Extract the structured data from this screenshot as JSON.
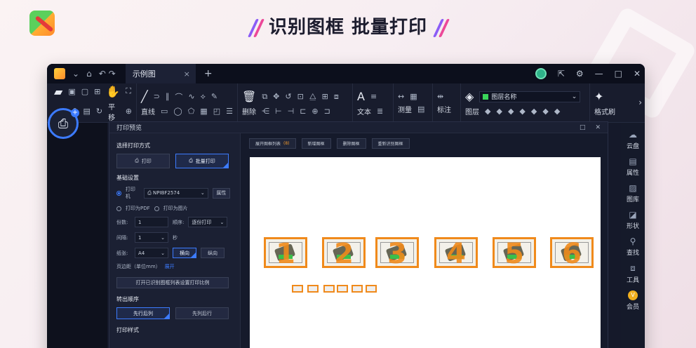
{
  "headline": "识别图框 批量打印",
  "titlebar": {
    "tab_title": "示例图",
    "close": "×",
    "new_tab": "+",
    "min": "—",
    "max": "□",
    "close_window": "✕"
  },
  "toolbar": {
    "pan_label": "平移",
    "line_label": "直线",
    "delete_label": "删除",
    "text_label": "文本",
    "measure_label": "测量",
    "annotate_label": "标注",
    "layer_label": "图层",
    "layer_select": "图层名称",
    "format_label": "格式刷"
  },
  "right_sidebar": [
    {
      "label": "云盘",
      "icon": "cloud-icon"
    },
    {
      "label": "属性",
      "icon": "properties-icon"
    },
    {
      "label": "图库",
      "icon": "gallery-icon"
    },
    {
      "label": "形状",
      "icon": "shape-icon"
    },
    {
      "label": "查找",
      "icon": "find-icon"
    },
    {
      "label": "工具",
      "icon": "toolbox-icon"
    },
    {
      "label": "会员",
      "icon": "vip-icon"
    }
  ],
  "dialog": {
    "title": "打印预览",
    "print_mode_title": "选择打印方式",
    "print_btn": "打印",
    "batch_print_btn": "批量打印",
    "basic_settings": "基础设置",
    "printer_label": "打印机",
    "printer_value": "NPIBF2574",
    "attr_btn": "属性",
    "print_pdf": "打印为PDF",
    "print_image": "打印为图片",
    "copies_label": "份数:",
    "copies_value": "1",
    "order_label": "顺序:",
    "order_value": "逐份打印",
    "interval_label": "间隔:",
    "interval_value": "1",
    "interval_unit": "秒",
    "paper_label": "纸张:",
    "paper_value": "A4",
    "landscape": "横向",
    "portrait": "纵向",
    "margin_label": "页边距（单位mm）",
    "expand": "展开",
    "open_list_btn": "打开已识别图框列表设置打印比例",
    "output_order": "转出顺序",
    "col_first": "先行后列",
    "row_first": "先列后行",
    "print_style": "打印样式"
  },
  "actions": {
    "expand_list": "展开图框列表",
    "expand_count": "(8)",
    "add_frame": "新增图框",
    "delete_frame": "删除图框",
    "reidentify": "重新识别图框"
  },
  "frames": [
    "1",
    "2",
    "3",
    "4",
    "5",
    "6"
  ],
  "colors": {
    "accent": "#3c7bff",
    "frame_orange": "#f08a1b"
  }
}
